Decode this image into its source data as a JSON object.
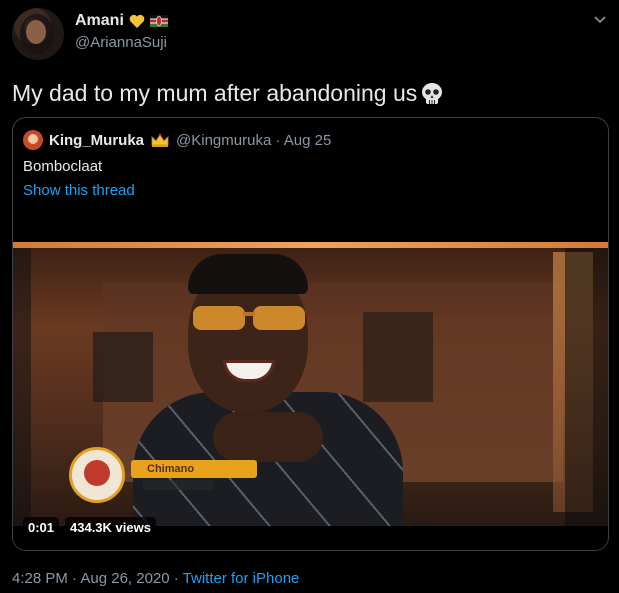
{
  "tweet": {
    "display_name": "Amani",
    "handle": "@AriannaSuji",
    "text": "My dad to my mum after abandoning us",
    "timestamp": "4:28 PM · Aug 26, 2020 · ",
    "source": "Twitter for iPhone"
  },
  "quoted": {
    "display_name": "King_Muruka",
    "handle_date": "@Kingmuruka · Aug 25",
    "text": "Bomboclaat",
    "thread_link": "Show this thread"
  },
  "video": {
    "duration": "0:01",
    "views": "434.3K views",
    "nameplate": "Chimano"
  },
  "icons": {
    "heart": "yellow-heart-icon",
    "flag": "kenya-flag-icon",
    "skull": "skull-icon",
    "crown": "crown-icon",
    "chevron": "chevron-down-icon"
  },
  "colors": {
    "background": "#000000",
    "link": "#1da1f2",
    "secondary_text": "#8899a6"
  }
}
